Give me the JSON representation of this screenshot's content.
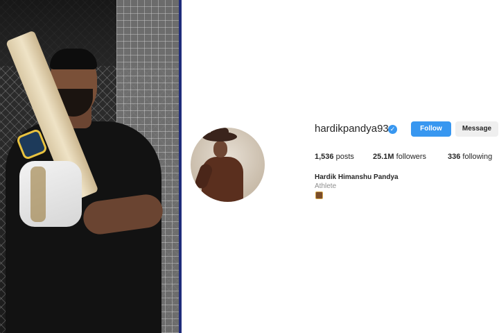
{
  "profile": {
    "username": "hardikpandya93",
    "verified_icon": "verified-badge-icon",
    "full_name": "Hardik Himanshu Pandya",
    "category": "Athlete",
    "bio_icon": "emoji-icon"
  },
  "actions": {
    "follow_label": "Follow",
    "message_label": "Message"
  },
  "stats": {
    "posts_count": "1,536",
    "posts_label": "posts",
    "followers_count": "25.1M",
    "followers_label": "followers",
    "following_count": "336",
    "following_label": "following"
  },
  "colors": {
    "accent": "#3897f0",
    "divider": "#1f2c7a"
  }
}
